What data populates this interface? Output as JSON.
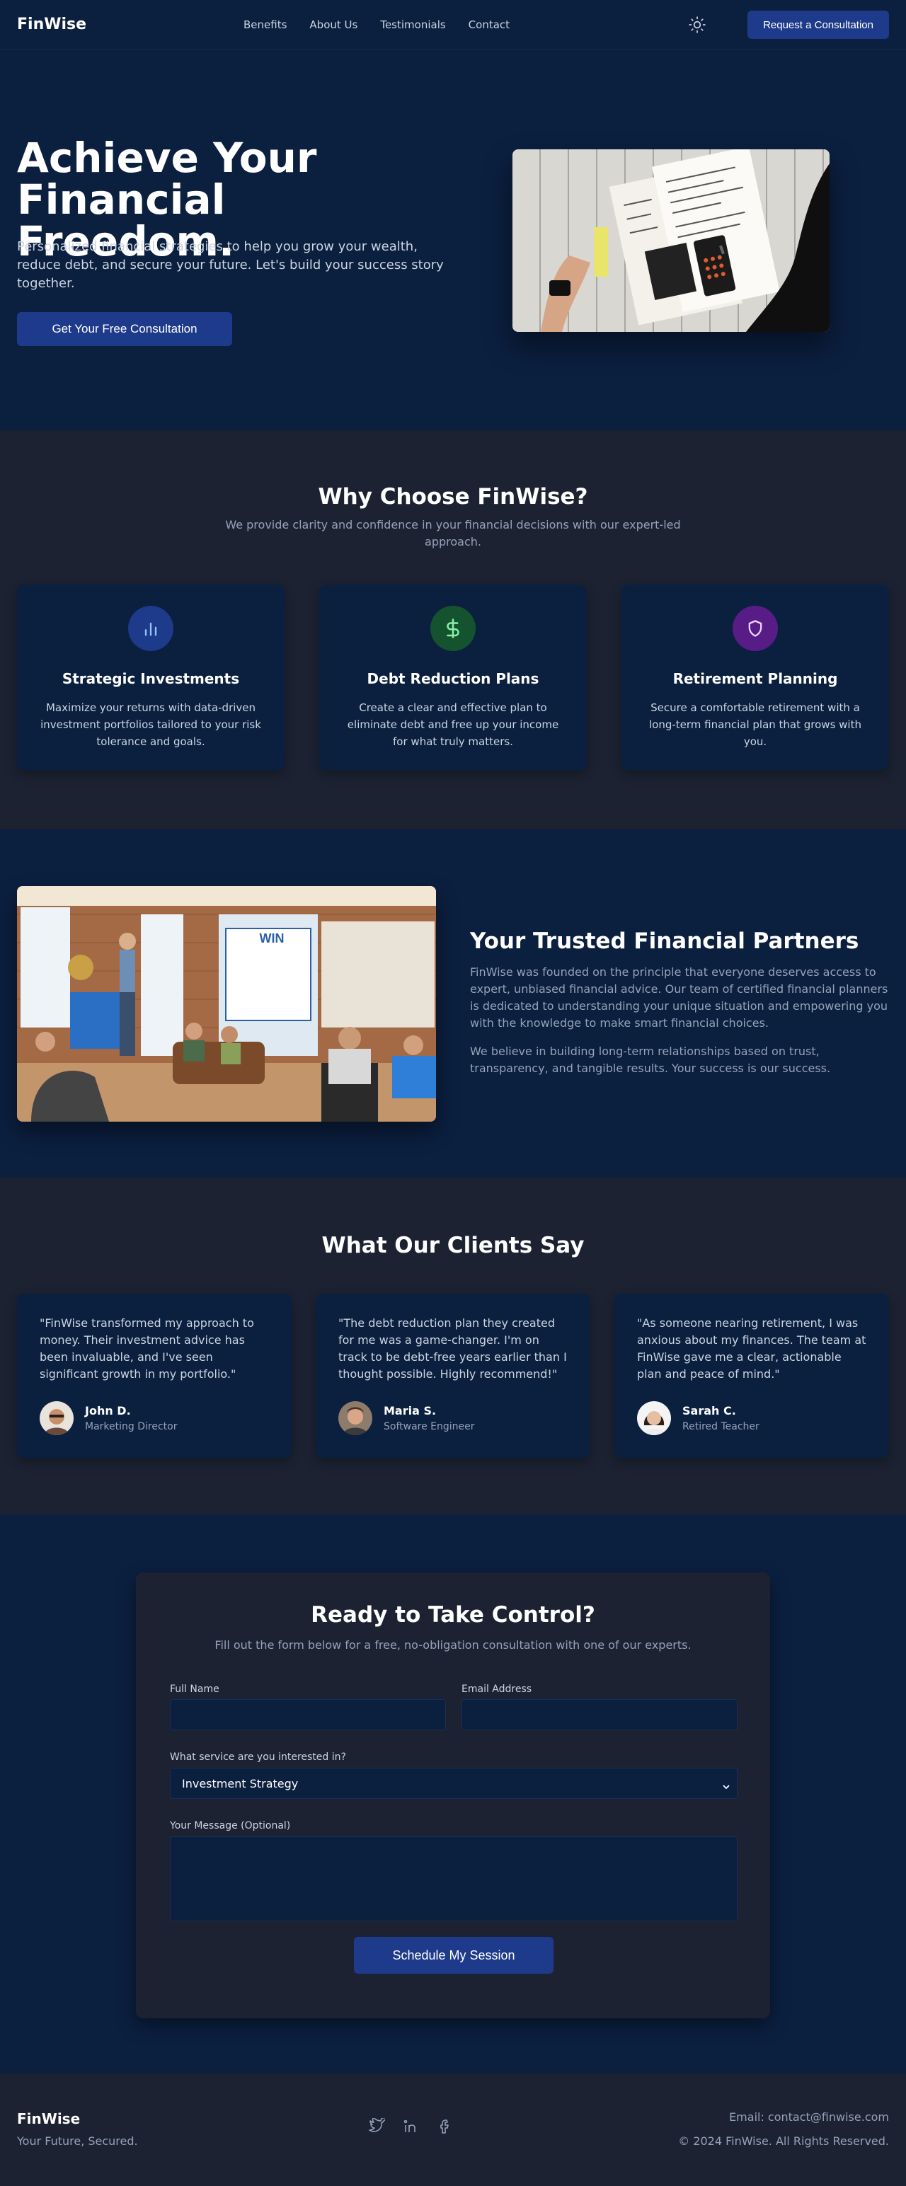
{
  "nav": {
    "brand": "FinWise",
    "links": [
      "Benefits",
      "About Us",
      "Testimonials",
      "Contact"
    ],
    "cta": "Request a Consultation",
    "theme_icon": "sun-icon"
  },
  "hero": {
    "title": "Achieve Your Financial Freedom.",
    "subtitle": "Personalized financial strategies to help you grow your wealth, reduce debt, and secure your future. Let's build your success story together.",
    "button": "Get Your Free Consultation"
  },
  "why": {
    "title": "Why Choose FinWise?",
    "subtitle": "We provide clarity and confidence in your financial decisions with our expert-led approach.",
    "cards": [
      {
        "icon": "bar-chart-icon",
        "icon_bg": "#1e3a8a",
        "title": "Strategic Investments",
        "text": "Maximize your returns with data-driven investment portfolios tailored to your risk tolerance and goals."
      },
      {
        "icon": "dollar-icon",
        "icon_bg": "#14532d",
        "title": "Debt Reduction Plans",
        "text": "Create a clear and effective plan to eliminate debt and free up your income for what truly matters."
      },
      {
        "icon": "shield-icon",
        "icon_bg": "#581c87",
        "title": "Retirement Planning",
        "text": "Secure a comfortable retirement with a long-term financial plan that grows with you."
      }
    ]
  },
  "about": {
    "title": "Your Trusted Financial Partners",
    "p1": "FinWise was founded on the principle that everyone deserves access to expert, unbiased financial advice. Our team of certified financial planners is dedicated to understanding your unique situation and empowering you with the knowledge to make smart financial choices.",
    "p2": "We believe in building long-term relationships based on trust, transparency, and tangible results. Your success is our success."
  },
  "testimonials": {
    "title": "What Our Clients Say",
    "items": [
      {
        "quote": "\"FinWise transformed my approach to money. Their investment advice has been invaluable, and I've seen significant growth in my portfolio.\"",
        "name": "John D.",
        "role": "Marketing Director"
      },
      {
        "quote": "\"The debt reduction plan they created for me was a game-changer. I'm on track to be debt-free years earlier than I thought possible. Highly recommend!\"",
        "name": "Maria S.",
        "role": "Software Engineer"
      },
      {
        "quote": "\"As someone nearing retirement, I was anxious about my finances. The team at FinWise gave me a clear, actionable plan and peace of mind.\"",
        "name": "Sarah C.",
        "role": "Retired Teacher"
      }
    ]
  },
  "contact": {
    "title": "Ready to Take Control?",
    "subtitle": "Fill out the form below for a free, no-obligation consultation with one of our experts.",
    "name_label": "Full Name",
    "name_value": "",
    "email_label": "Email Address",
    "email_value": "",
    "service_label": "What service are you interested in?",
    "service_value": "Investment Strategy",
    "message_label": "Your Message (Optional)",
    "message_value": "",
    "submit": "Schedule My Session"
  },
  "footer": {
    "brand": "FinWise",
    "tagline": "Your Future, Secured.",
    "social": [
      "twitter-icon",
      "linkedin-icon",
      "facebook-icon"
    ],
    "email": "Email: contact@finwise.com",
    "copyright": "© 2024 FinWise. All Rights Reserved."
  }
}
